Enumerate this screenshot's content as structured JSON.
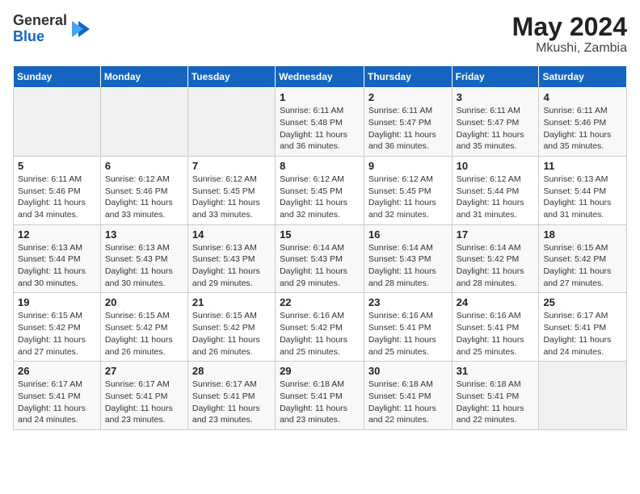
{
  "header": {
    "logo_general": "General",
    "logo_blue": "Blue",
    "month_year": "May 2024",
    "location": "Mkushi, Zambia"
  },
  "days_of_week": [
    "Sunday",
    "Monday",
    "Tuesday",
    "Wednesday",
    "Thursday",
    "Friday",
    "Saturday"
  ],
  "weeks": [
    [
      {
        "num": "",
        "detail": ""
      },
      {
        "num": "",
        "detail": ""
      },
      {
        "num": "",
        "detail": ""
      },
      {
        "num": "1",
        "detail": "Sunrise: 6:11 AM\nSunset: 5:48 PM\nDaylight: 11 hours\nand 36 minutes."
      },
      {
        "num": "2",
        "detail": "Sunrise: 6:11 AM\nSunset: 5:47 PM\nDaylight: 11 hours\nand 36 minutes."
      },
      {
        "num": "3",
        "detail": "Sunrise: 6:11 AM\nSunset: 5:47 PM\nDaylight: 11 hours\nand 35 minutes."
      },
      {
        "num": "4",
        "detail": "Sunrise: 6:11 AM\nSunset: 5:46 PM\nDaylight: 11 hours\nand 35 minutes."
      }
    ],
    [
      {
        "num": "5",
        "detail": "Sunrise: 6:11 AM\nSunset: 5:46 PM\nDaylight: 11 hours\nand 34 minutes."
      },
      {
        "num": "6",
        "detail": "Sunrise: 6:12 AM\nSunset: 5:46 PM\nDaylight: 11 hours\nand 33 minutes."
      },
      {
        "num": "7",
        "detail": "Sunrise: 6:12 AM\nSunset: 5:45 PM\nDaylight: 11 hours\nand 33 minutes."
      },
      {
        "num": "8",
        "detail": "Sunrise: 6:12 AM\nSunset: 5:45 PM\nDaylight: 11 hours\nand 32 minutes."
      },
      {
        "num": "9",
        "detail": "Sunrise: 6:12 AM\nSunset: 5:45 PM\nDaylight: 11 hours\nand 32 minutes."
      },
      {
        "num": "10",
        "detail": "Sunrise: 6:12 AM\nSunset: 5:44 PM\nDaylight: 11 hours\nand 31 minutes."
      },
      {
        "num": "11",
        "detail": "Sunrise: 6:13 AM\nSunset: 5:44 PM\nDaylight: 11 hours\nand 31 minutes."
      }
    ],
    [
      {
        "num": "12",
        "detail": "Sunrise: 6:13 AM\nSunset: 5:44 PM\nDaylight: 11 hours\nand 30 minutes."
      },
      {
        "num": "13",
        "detail": "Sunrise: 6:13 AM\nSunset: 5:43 PM\nDaylight: 11 hours\nand 30 minutes."
      },
      {
        "num": "14",
        "detail": "Sunrise: 6:13 AM\nSunset: 5:43 PM\nDaylight: 11 hours\nand 29 minutes."
      },
      {
        "num": "15",
        "detail": "Sunrise: 6:14 AM\nSunset: 5:43 PM\nDaylight: 11 hours\nand 29 minutes."
      },
      {
        "num": "16",
        "detail": "Sunrise: 6:14 AM\nSunset: 5:43 PM\nDaylight: 11 hours\nand 28 minutes."
      },
      {
        "num": "17",
        "detail": "Sunrise: 6:14 AM\nSunset: 5:42 PM\nDaylight: 11 hours\nand 28 minutes."
      },
      {
        "num": "18",
        "detail": "Sunrise: 6:15 AM\nSunset: 5:42 PM\nDaylight: 11 hours\nand 27 minutes."
      }
    ],
    [
      {
        "num": "19",
        "detail": "Sunrise: 6:15 AM\nSunset: 5:42 PM\nDaylight: 11 hours\nand 27 minutes."
      },
      {
        "num": "20",
        "detail": "Sunrise: 6:15 AM\nSunset: 5:42 PM\nDaylight: 11 hours\nand 26 minutes."
      },
      {
        "num": "21",
        "detail": "Sunrise: 6:15 AM\nSunset: 5:42 PM\nDaylight: 11 hours\nand 26 minutes."
      },
      {
        "num": "22",
        "detail": "Sunrise: 6:16 AM\nSunset: 5:42 PM\nDaylight: 11 hours\nand 25 minutes."
      },
      {
        "num": "23",
        "detail": "Sunrise: 6:16 AM\nSunset: 5:41 PM\nDaylight: 11 hours\nand 25 minutes."
      },
      {
        "num": "24",
        "detail": "Sunrise: 6:16 AM\nSunset: 5:41 PM\nDaylight: 11 hours\nand 25 minutes."
      },
      {
        "num": "25",
        "detail": "Sunrise: 6:17 AM\nSunset: 5:41 PM\nDaylight: 11 hours\nand 24 minutes."
      }
    ],
    [
      {
        "num": "26",
        "detail": "Sunrise: 6:17 AM\nSunset: 5:41 PM\nDaylight: 11 hours\nand 24 minutes."
      },
      {
        "num": "27",
        "detail": "Sunrise: 6:17 AM\nSunset: 5:41 PM\nDaylight: 11 hours\nand 23 minutes."
      },
      {
        "num": "28",
        "detail": "Sunrise: 6:17 AM\nSunset: 5:41 PM\nDaylight: 11 hours\nand 23 minutes."
      },
      {
        "num": "29",
        "detail": "Sunrise: 6:18 AM\nSunset: 5:41 PM\nDaylight: 11 hours\nand 23 minutes."
      },
      {
        "num": "30",
        "detail": "Sunrise: 6:18 AM\nSunset: 5:41 PM\nDaylight: 11 hours\nand 22 minutes."
      },
      {
        "num": "31",
        "detail": "Sunrise: 6:18 AM\nSunset: 5:41 PM\nDaylight: 11 hours\nand 22 minutes."
      },
      {
        "num": "",
        "detail": ""
      }
    ]
  ]
}
